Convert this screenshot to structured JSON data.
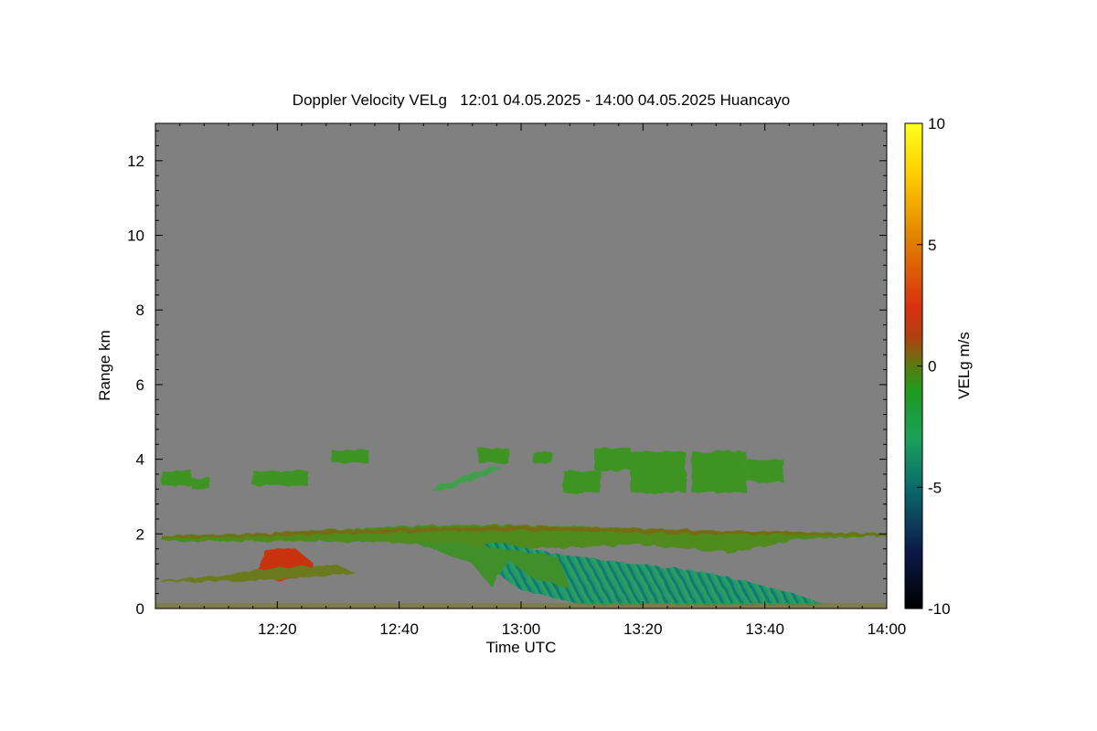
{
  "chart_data": {
    "type": "heatmap",
    "title": "Doppler Velocity VELg   12:01 04.05.2025 - 14:00 04.05.2025 Huancayo",
    "xlabel": "Time UTC",
    "ylabel": "Range km",
    "colorbar_label": "VELg m/s",
    "x_range": [
      "12:01",
      "14:00"
    ],
    "x_ticks": [
      "12:20",
      "12:40",
      "13:00",
      "13:20",
      "13:40",
      "14:00"
    ],
    "ylim": [
      0,
      13
    ],
    "y_ticks": [
      0,
      2,
      4,
      6,
      8,
      10,
      12
    ],
    "colorbar_range": [
      -10,
      10
    ],
    "colorbar_ticks": [
      -10,
      -5,
      0,
      5,
      10
    ],
    "colorbar_tick_labels": [
      "-10",
      "-5",
      "0",
      "5",
      "10"
    ],
    "background_color": "#808080",
    "colormap": [
      "#000000",
      "#0b1a4a",
      "#0b6b6b",
      "#1aa05a",
      "#1f9a1f",
      "#5a7a10",
      "#b04010",
      "#d83010",
      "#e07a00",
      "#ffd000",
      "#ffff20"
    ],
    "features": [
      {
        "name": "low cloud layer",
        "time_start": "12:01",
        "time_end": "14:00",
        "range_km": [
          1.8,
          2.3
        ],
        "velocity_ms": -0.5
      },
      {
        "name": "mid cloud patches",
        "time_start": "12:01",
        "time_end": "13:43",
        "range_km": [
          3.0,
          4.4
        ],
        "velocity_ms": -1.0
      },
      {
        "name": "precipitation fall streaks",
        "time_start": "12:55",
        "time_end": "13:50",
        "range_km": [
          0,
          1.8
        ],
        "velocity_ms": -3.5
      },
      {
        "name": "updraft region",
        "time_start": "12:18",
        "time_end": "12:26",
        "range_km": [
          0.7,
          1.6
        ],
        "velocity_ms": 1.5
      }
    ]
  }
}
